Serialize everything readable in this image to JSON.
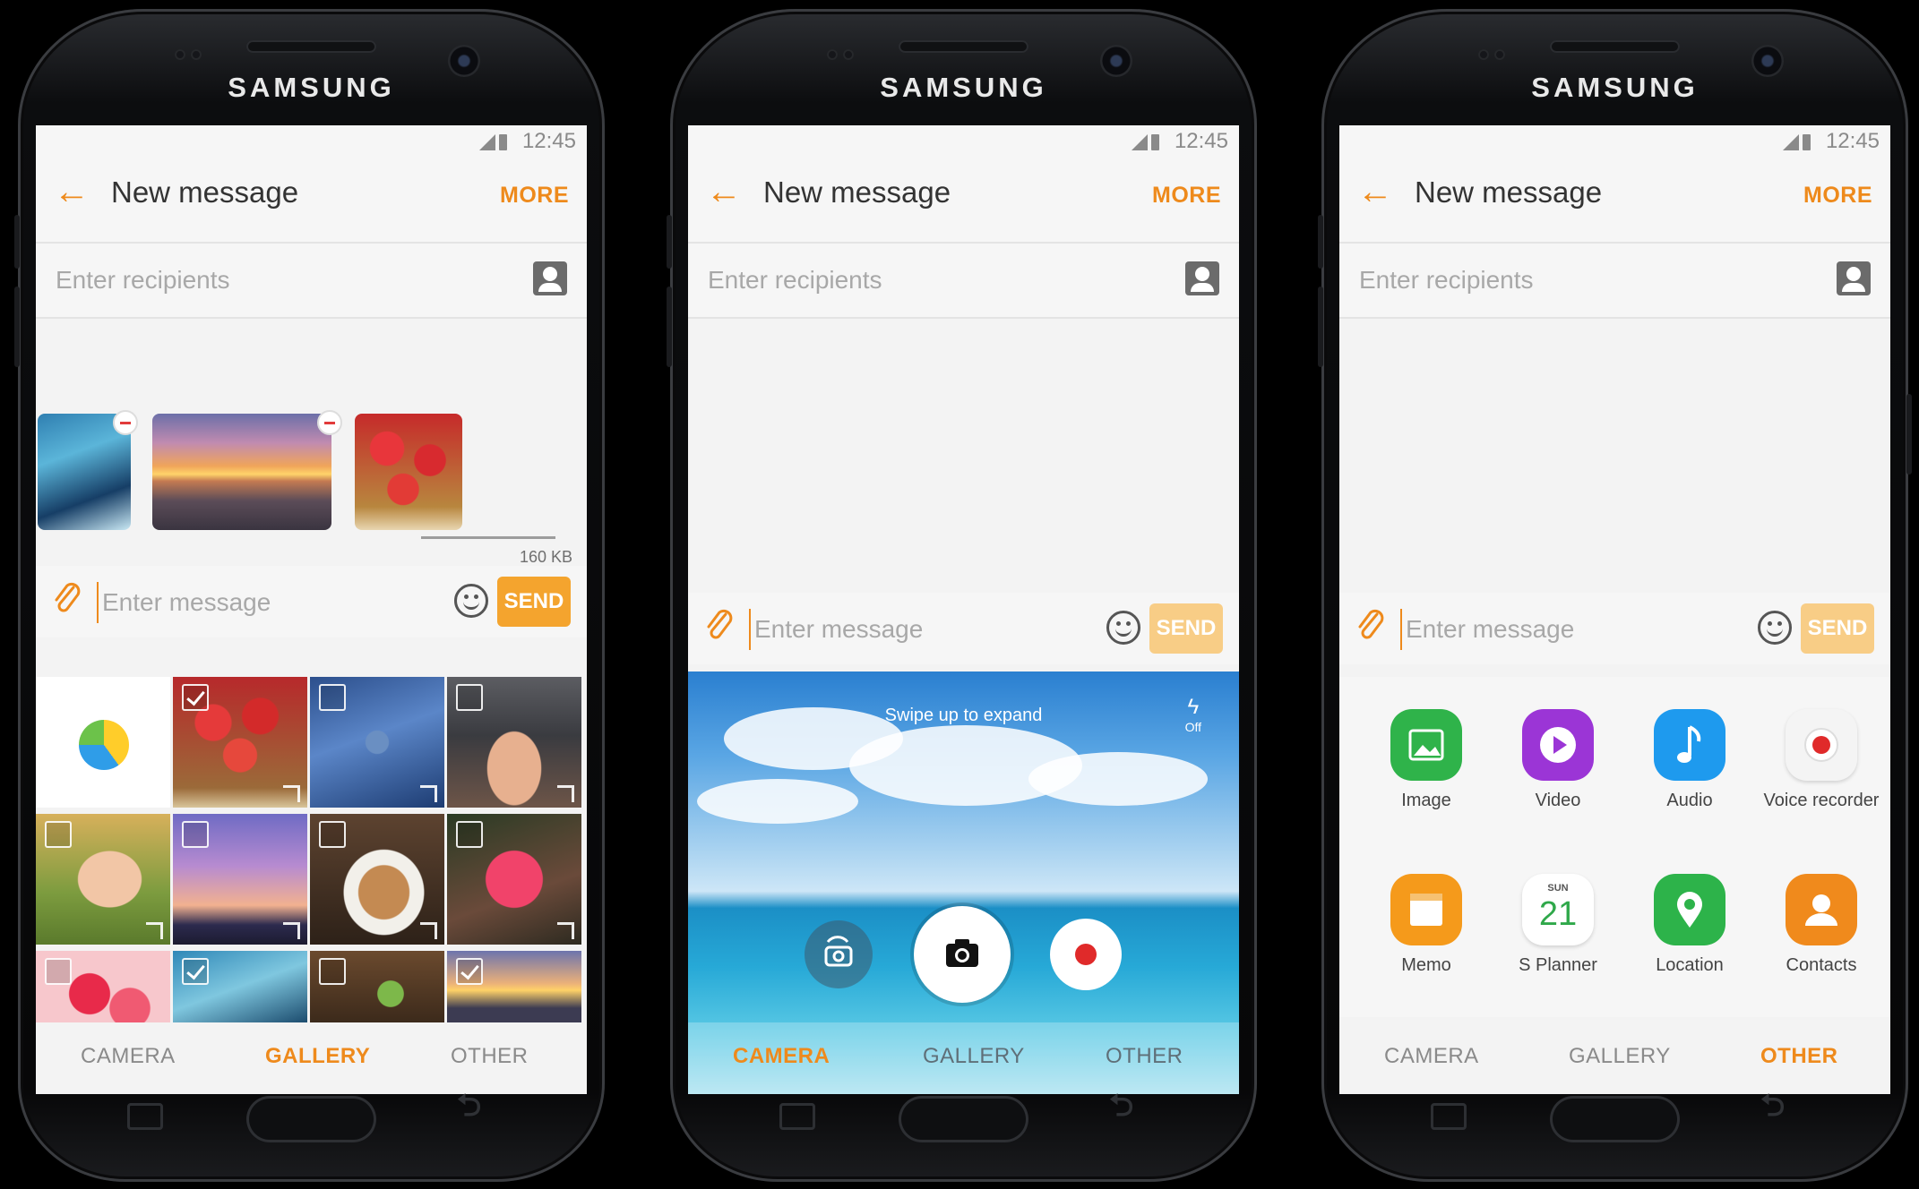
{
  "brand": "SAMSUNG",
  "status": {
    "time": "12:45"
  },
  "appbar": {
    "back": "←",
    "title": "New message",
    "more": "MORE"
  },
  "recipients": {
    "placeholder": "Enter recipients"
  },
  "composer": {
    "placeholder": "Enter message",
    "send": "SEND"
  },
  "tabs": [
    "CAMERA",
    "GALLERY",
    "OTHER"
  ],
  "phone1": {
    "active_tab": "GALLERY",
    "attachment_size": "160 KB"
  },
  "phone2": {
    "active_tab": "CAMERA",
    "swipe_hint": "Swipe up to expand",
    "flash": "Off"
  },
  "phone3": {
    "active_tab": "OTHER",
    "items": [
      {
        "label": "Image",
        "icon": "image-icon",
        "color": "#2fb34a"
      },
      {
        "label": "Video",
        "icon": "video-icon",
        "color": "#9b35d6"
      },
      {
        "label": "Audio",
        "icon": "audio-icon",
        "color": "#1e9aee"
      },
      {
        "label": "Voice recorder",
        "icon": "voice-recorder-icon",
        "color": "#f4f4f4"
      },
      {
        "label": "Memo",
        "icon": "memo-icon",
        "color": "#f59a1b"
      },
      {
        "label": "S Planner",
        "icon": "calendar-icon",
        "color": "#ffffff",
        "day_name": "SUN",
        "day": "21"
      },
      {
        "label": "Location",
        "icon": "location-icon",
        "color": "#2db34a"
      },
      {
        "label": "Contacts",
        "icon": "contacts-icon",
        "color": "#f08a1c"
      }
    ]
  },
  "colors": {
    "accent": "#ee8a1c",
    "send_active": "#f4a42e",
    "send_disabled": "#f8cd86"
  }
}
